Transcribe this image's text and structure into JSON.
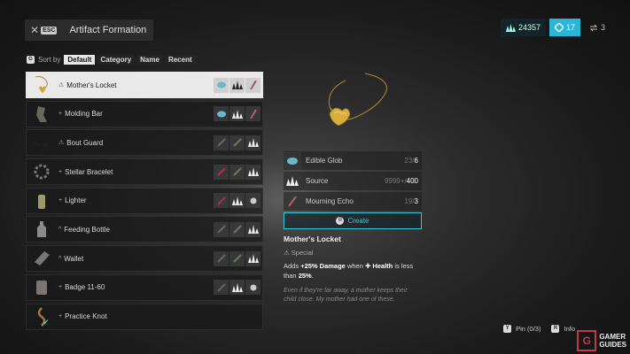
{
  "header": {
    "close_key": "ESC",
    "title": "Artifact Formation"
  },
  "currency": {
    "primary": "24357",
    "cyan": "17",
    "plain": "3"
  },
  "sort": {
    "key": "G",
    "label": "Sort by",
    "options": [
      "Default",
      "Category",
      "Name",
      "Recent"
    ],
    "active": 0
  },
  "list": [
    {
      "name": "Mother's Locket",
      "rank": "⚠",
      "mats": [
        "glob",
        "source",
        "echo"
      ]
    },
    {
      "name": "Molding Bar",
      "rank": "+",
      "mats": [
        "glob",
        "source",
        "echo"
      ]
    },
    {
      "name": "Bout Guard",
      "rank": "⚠",
      "mats": [
        "dim",
        "dim",
        "source"
      ]
    },
    {
      "name": "Stellar Bracelet",
      "rank": "+",
      "mats": [
        "red",
        "dim",
        "source"
      ]
    },
    {
      "name": "Lighter",
      "rank": "+",
      "mats": [
        "red",
        "source",
        "white"
      ]
    },
    {
      "name": "Feeding Bottle",
      "rank": "^",
      "mats": [
        "dim",
        "dim",
        "source"
      ]
    },
    {
      "name": "Wallet",
      "rank": "^",
      "mats": [
        "dim",
        "dim",
        "source"
      ]
    },
    {
      "name": "Badge 11-60",
      "rank": "+",
      "mats": [
        "dim",
        "source",
        "white"
      ]
    },
    {
      "name": "Practice Knot",
      "rank": "+",
      "mats": []
    }
  ],
  "detail": {
    "materials": [
      {
        "name": "Edible Glob",
        "have": "23",
        "need": "6",
        "icon": "glob"
      },
      {
        "name": "Source",
        "have": "9999+",
        "need": "400",
        "icon": "source"
      },
      {
        "name": "Mourning Echo",
        "have": "19",
        "need": "3",
        "icon": "echo"
      }
    ],
    "create_key": "B",
    "create_label": "Create",
    "title": "Mother's Locket",
    "type": "⚠ Special",
    "desc_adds": "Adds ",
    "desc_pct1": "+25%",
    "desc_damage": " Damage",
    "desc_when": " when ",
    "desc_health": "✚ Health",
    "desc_less": " is less than ",
    "desc_pct2": "25%",
    "desc_end": ".",
    "flavor": "Even if they're far away, a mother keeps their child close. My mother had one of these."
  },
  "footer": {
    "pin_key": "Y",
    "pin_label": "Pin (0/3)",
    "info_key": "R",
    "info_label": "Info"
  },
  "watermark": {
    "line1": "GAMER",
    "line2": "GUIDES"
  }
}
